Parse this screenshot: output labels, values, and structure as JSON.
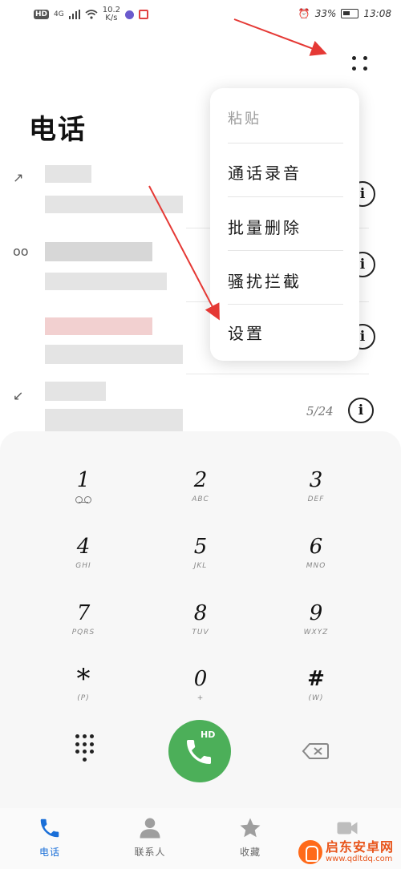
{
  "status_bar": {
    "left_badge": "HD",
    "network": "4G",
    "speed_value": "10.2",
    "speed_unit": "K/s",
    "battery": "33%",
    "time": "13:08"
  },
  "header": {
    "title": "电话"
  },
  "call_log": {
    "last_count": "5/24"
  },
  "popup_menu": {
    "items": [
      {
        "label": "粘贴",
        "enabled": false
      },
      {
        "label": "通话录音",
        "enabled": true
      },
      {
        "label": "批量删除",
        "enabled": true
      },
      {
        "label": "骚扰拦截",
        "enabled": true
      },
      {
        "label": "设置",
        "enabled": true
      }
    ]
  },
  "dialpad": {
    "keys": [
      {
        "digit": "1",
        "letters": ""
      },
      {
        "digit": "2",
        "letters": "ABC"
      },
      {
        "digit": "3",
        "letters": "DEF"
      },
      {
        "digit": "4",
        "letters": "GHI"
      },
      {
        "digit": "5",
        "letters": "JKL"
      },
      {
        "digit": "6",
        "letters": "MNO"
      },
      {
        "digit": "7",
        "letters": "PQRS"
      },
      {
        "digit": "8",
        "letters": "TUV"
      },
      {
        "digit": "9",
        "letters": "WXYZ"
      },
      {
        "digit": "*",
        "letters": "(P)"
      },
      {
        "digit": "0",
        "letters": "+"
      },
      {
        "digit": "#",
        "letters": "(W)"
      }
    ],
    "call_badge": "HD"
  },
  "bottom_nav": {
    "items": [
      {
        "label": "电话",
        "icon": "phone-icon",
        "active": true
      },
      {
        "label": "联系人",
        "icon": "contacts-icon",
        "active": false
      },
      {
        "label": "收藏",
        "icon": "star-icon",
        "active": false
      },
      {
        "label": "",
        "icon": "video-icon",
        "active": false
      }
    ]
  },
  "watermark": {
    "name": "启东安卓网",
    "url": "www.qdltdq.com"
  },
  "colors": {
    "call_green": "#4caf59",
    "active_blue": "#1a6fd8",
    "annotation_red": "#e53935"
  }
}
